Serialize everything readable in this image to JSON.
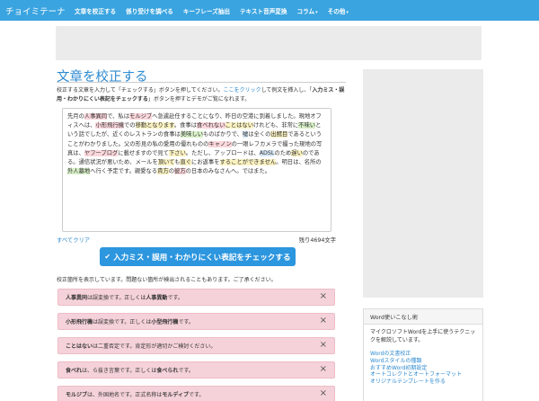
{
  "navbar": {
    "brand": "チョイミテーナ",
    "items": [
      {
        "label": "文章を校正する"
      },
      {
        "label": "係り受けを調べる"
      },
      {
        "label": "キーフレーズ抽出"
      },
      {
        "label": "テキスト音声変換"
      },
      {
        "label": "コラム"
      },
      {
        "label": "その他"
      }
    ],
    "caret": "▾"
  },
  "page": {
    "title": "文章を校正する",
    "intro_1": "校正する文章を入力して「チェックする」ボタンを押してください。",
    "intro_link": "ここをクリック",
    "intro_2": "して例文を挿入し、「",
    "intro_bold": "入力ミス・誤用・わかりにくい表記をチェックする",
    "intro_3": "」ボタンを押すとデモがご覧になれます。"
  },
  "editor": {
    "segments": [
      {
        "t": "先月の",
        "c": ""
      },
      {
        "t": "人事異同",
        "c": "hl-red"
      },
      {
        "t": "で、私は",
        "c": ""
      },
      {
        "t": "モルジブ",
        "c": "hl-red"
      },
      {
        "t": "へ急遽赴任することになり、昨日の空港に到着しました。現地オフィスへは、",
        "c": ""
      },
      {
        "t": "小形飛行機",
        "c": "hl-red"
      },
      {
        "t": "での",
        "c": ""
      },
      {
        "t": "移動となります",
        "c": "hl-yel"
      },
      {
        "t": "。食事は",
        "c": ""
      },
      {
        "t": "食べれない",
        "c": "hl-red"
      },
      {
        "t": "ことはない",
        "c": "hl-yel"
      },
      {
        "t": "けれども、非常に",
        "c": ""
      },
      {
        "t": "不味い",
        "c": "hl-grn"
      },
      {
        "t": "という話でしたが、近くのレストランの食事は",
        "c": ""
      },
      {
        "t": "美味しい",
        "c": "hl-grn"
      },
      {
        "t": "ものばかりで、",
        "c": ""
      },
      {
        "t": "嘘",
        "c": "hl-blu"
      },
      {
        "t": "は全くの",
        "c": ""
      },
      {
        "t": "出鱈目",
        "c": "hl-yel"
      },
      {
        "t": "であるということがわかりました。父の形見の私の愛用の優れものの",
        "c": ""
      },
      {
        "t": "キャノン",
        "c": "hl-red"
      },
      {
        "t": "の一眼レフカメラで撮った現地の写真は、",
        "c": ""
      },
      {
        "t": "ヤフーブログ",
        "c": "hl-red"
      },
      {
        "t": "に載せますので見て",
        "c": ""
      },
      {
        "t": "下さい",
        "c": "hl-yel"
      },
      {
        "t": "。ただし、アップロードは、",
        "c": ""
      },
      {
        "t": "ADSL",
        "c": "hl-blu"
      },
      {
        "t": "のため",
        "c": ""
      },
      {
        "t": "遅い",
        "c": "hl-yel"
      },
      {
        "t": "のである。通信状況が悪いため、メールを",
        "c": ""
      },
      {
        "t": "頂いて",
        "c": "hl-yel"
      },
      {
        "t": "も",
        "c": ""
      },
      {
        "t": "直ぐ",
        "c": "hl-yel"
      },
      {
        "t": "にお返事を",
        "c": ""
      },
      {
        "t": "することができません",
        "c": "hl-yel"
      },
      {
        "t": "。明日は、名所の",
        "c": ""
      },
      {
        "t": "外人墓地",
        "c": "hl-grn"
      },
      {
        "t": "へ行く予定です。親愛なる",
        "c": ""
      },
      {
        "t": "貴方",
        "c": "hl-yel"
      },
      {
        "t": "の",
        "c": ""
      },
      {
        "t": "彼方",
        "c": "hl-red"
      },
      {
        "t": "の日本のみなさんへ。ではまた。",
        "c": ""
      }
    ]
  },
  "controls": {
    "clear": "すべてクリア",
    "remaining": "残り4694文字",
    "check_icon": "✔",
    "check_button": "入力ミス・誤用・わかりにくい表記をチェックする",
    "result_note": "校正箇所を表示しています。問題ない箇所が検出されることもあります。ご了承ください。"
  },
  "alerts": [
    {
      "b1": "人事異同",
      "m1": " は誤変換です。正しくは",
      "b2": "人事異動",
      "m2": "です。"
    },
    {
      "b1": "小形飛行機",
      "m1": " は誤変換です。正しくは",
      "b2": "小型飛行機",
      "m2": "です。"
    },
    {
      "b1": "ことはない",
      "m1": " は二重否定です。肯定形が適切かご検討ください。",
      "b2": "",
      "m2": ""
    },
    {
      "b1": "食べれ",
      "m1": " は、ら抜き言葉です。正しくは ",
      "b2": "食べられ",
      "m2": "です。"
    },
    {
      "b1": "モルジブ",
      "m1": " は、外国地名です。正式名称は ",
      "b2": "モルディブ",
      "m2": "です。"
    }
  ],
  "alert_close": "×",
  "sidebar": {
    "panel_title": "Word使いこなし術",
    "panel_desc": "マイクロソフトWordを上手に使うテクニックを解説しています。",
    "links": [
      "Wordの文書校正",
      "Wordスタイルの種類",
      "おすすめWord初期設定",
      "オートコレクトとオートフォーマット",
      "オリジナルテンプレートを作る"
    ]
  }
}
